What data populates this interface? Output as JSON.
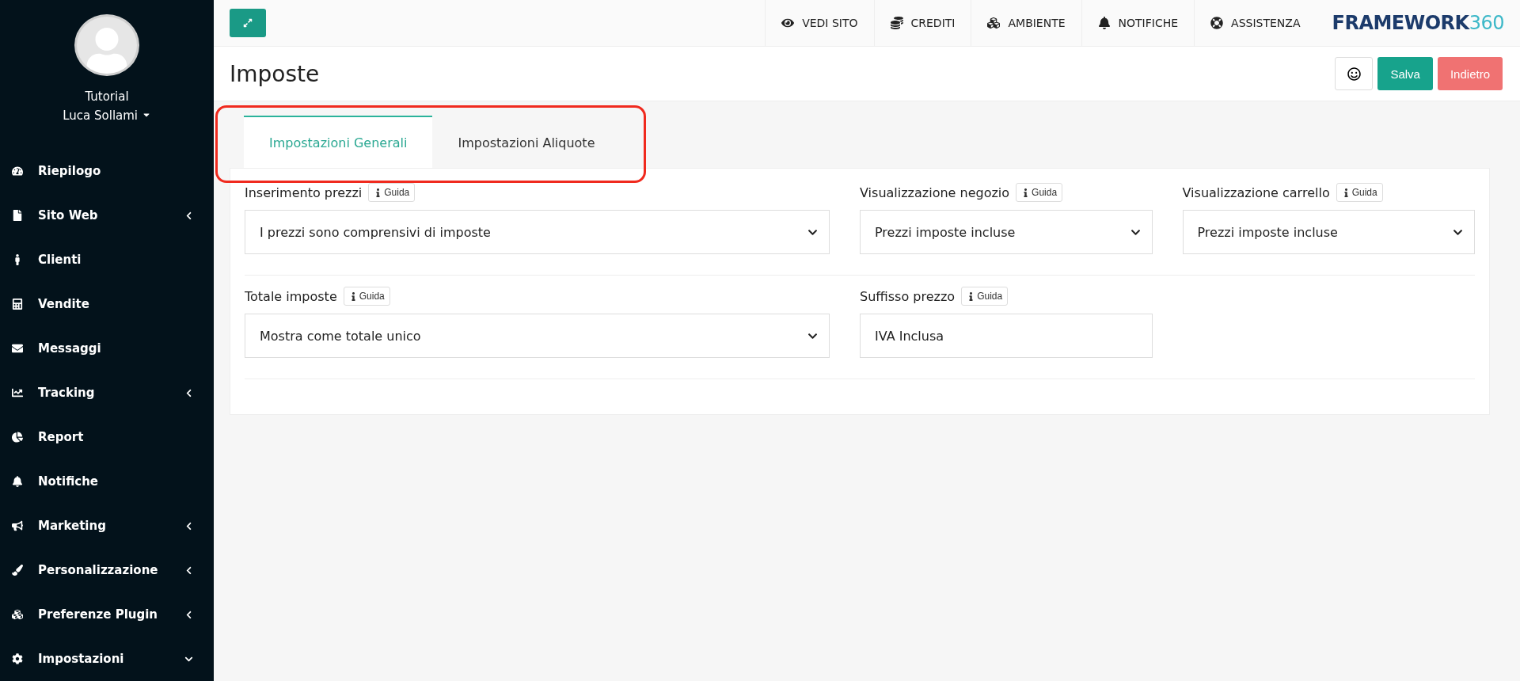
{
  "user": {
    "line1": "Tutorial",
    "line2": "Luca Sollami"
  },
  "sidebar": {
    "items": [
      {
        "label": "Riepilogo",
        "kind": "link"
      },
      {
        "label": "Sito Web",
        "kind": "group",
        "expanded": false
      },
      {
        "label": "Clienti",
        "kind": "link"
      },
      {
        "label": "Vendite",
        "kind": "link"
      },
      {
        "label": "Messaggi",
        "kind": "link"
      },
      {
        "label": "Tracking",
        "kind": "group",
        "expanded": false
      },
      {
        "label": "Report",
        "kind": "link"
      },
      {
        "label": "Notifiche",
        "kind": "link"
      },
      {
        "label": "Marketing",
        "kind": "group",
        "expanded": false
      },
      {
        "label": "Personalizzazione",
        "kind": "group",
        "expanded": false
      },
      {
        "label": "Preferenze Plugin",
        "kind": "group",
        "expanded": false
      },
      {
        "label": "Impostazioni",
        "kind": "group",
        "expanded": true
      }
    ]
  },
  "topbar": {
    "links": [
      "VEDI SITO",
      "CREDITI",
      "AMBIENTE",
      "NOTIFICHE",
      "ASSISTENZA"
    ],
    "logo": {
      "main": "FRAMEWORK",
      "accent": "360"
    }
  },
  "page": {
    "title": "Imposte",
    "buttons": [
      {
        "label": "Salva",
        "kind": "save"
      },
      {
        "label": "Indietro",
        "kind": "back"
      }
    ]
  },
  "tabs": [
    {
      "label": "Impostazioni Generali",
      "selected": true
    },
    {
      "label": "Impostazioni Aliquote",
      "selected": false
    }
  ],
  "rows": [
    [
      {
        "label": "Inserimento prezzi",
        "help": "Guida",
        "kind": "select",
        "value": "I prezzi sono comprensivi di imposte"
      },
      {
        "label": "Visualizzazione negozio",
        "help": "Guida",
        "kind": "select",
        "value": "Prezzi imposte incluse"
      },
      {
        "label": "Visualizzazione carrello",
        "help": "Guida",
        "kind": "select",
        "value": "Prezzi imposte incluse"
      }
    ],
    [
      {
        "label": "Totale imposte",
        "help": "Guida",
        "kind": "select",
        "value": "Mostra come totale unico"
      },
      {
        "label": "Suffisso prezzo",
        "help": "Guida",
        "kind": "text",
        "value": "IVA Inclusa"
      }
    ]
  ]
}
